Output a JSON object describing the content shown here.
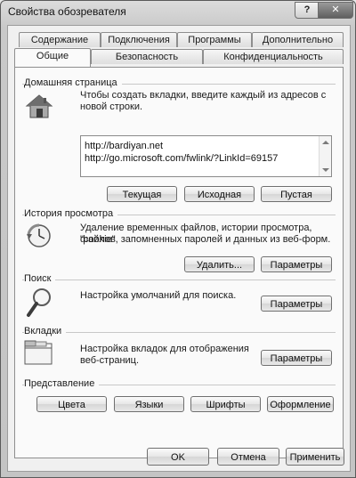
{
  "window": {
    "title": "Свойства обозревателя",
    "help_label": "?",
    "close_label": "✕"
  },
  "tabs": {
    "row1": [
      "Содержание",
      "Подключения",
      "Программы",
      "Дополнительно"
    ],
    "row2": [
      "Общие",
      "Безопасность",
      "Конфиденциальность"
    ]
  },
  "home": {
    "title": "Домашняя страница",
    "desc1": "Чтобы создать вкладки, введите каждый из адресов с",
    "desc2": "новой строки.",
    "urls": [
      "http://bardiyan.net",
      "http://go.microsoft.com/fwlink/?LinkId=69157"
    ],
    "btn_current": "Текущая",
    "btn_default": "Исходная",
    "btn_blank": "Пустая"
  },
  "history": {
    "title": "История просмотра",
    "desc1": "Удаление временных файлов, истории просмотра, файлов",
    "desc2": "\"cookie\", запомненных паролей и данных из веб-форм.",
    "btn_delete": "Удалить...",
    "btn_settings": "Параметры"
  },
  "search": {
    "title": "Поиск",
    "desc1": "Настройка умолчаний для поиска.",
    "btn_settings": "Параметры"
  },
  "tabs_group": {
    "title": "Вкладки",
    "desc1": "Настройка вкладок для отображения",
    "desc2": "веб-страниц.",
    "btn_settings": "Параметры"
  },
  "appearance": {
    "title": "Представление",
    "btn_colors": "Цвета",
    "btn_languages": "Языки",
    "btn_fonts": "Шрифты",
    "btn_design": "Оформление"
  },
  "footer": {
    "ok": "OK",
    "cancel": "Отмена",
    "apply": "Применить"
  }
}
